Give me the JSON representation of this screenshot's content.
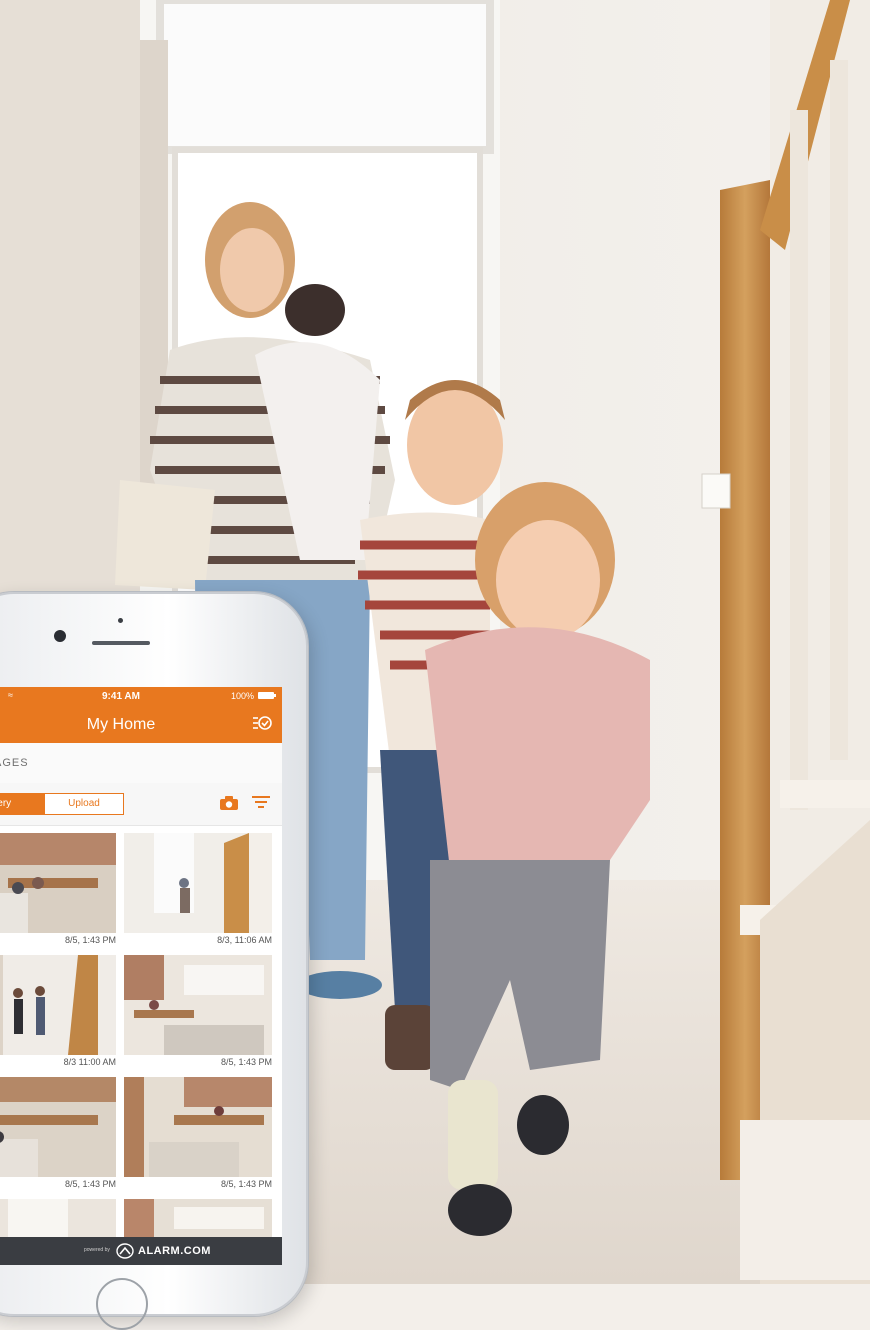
{
  "status_bar": {
    "time": "9:41 AM",
    "battery": "100%"
  },
  "app": {
    "title": "My Home"
  },
  "section": {
    "label": "AGES"
  },
  "toolbar": {
    "gallery_label": "llery",
    "upload_label": "Upload"
  },
  "gallery": [
    {
      "caption": "8/5, 1:43 PM"
    },
    {
      "caption": "8/3, 11:06 AM"
    },
    {
      "caption": "8/3 11:00 AM"
    },
    {
      "caption": "8/5, 1:43 PM"
    },
    {
      "caption": "8/5, 1:43 PM"
    },
    {
      "caption": "8/5, 1:43 PM"
    },
    {
      "caption": ""
    },
    {
      "caption": ""
    }
  ],
  "footer": {
    "powered_by": "powered by",
    "brand": "ALARM.COM"
  },
  "colors": {
    "accent": "#e8781f",
    "footer": "#3a3d42"
  },
  "icons": [
    "wifi-icon",
    "battery-icon",
    "menu-check-icon",
    "camera-icon",
    "filter-icon",
    "alarm-logo-icon"
  ]
}
